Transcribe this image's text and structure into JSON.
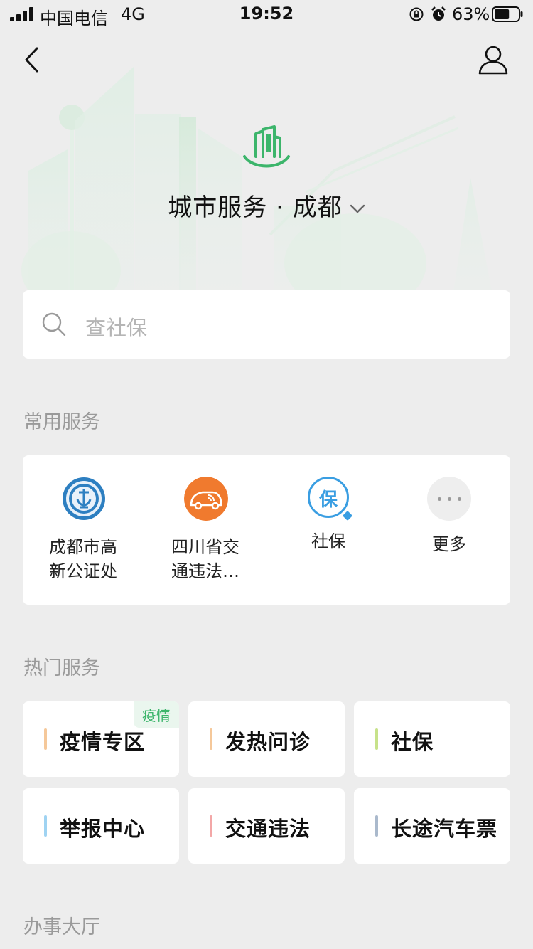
{
  "status_bar": {
    "carrier": "中国电信",
    "network": "4G",
    "time": "19:52",
    "battery_percent": "63%",
    "battery_level": 0.63
  },
  "header": {
    "back_icon": "chevron-left-icon",
    "profile_icon": "user-icon"
  },
  "hero": {
    "logo_icon": "city-building-icon",
    "title": "城市服务 · 成都",
    "accent_color": "#3cb56b"
  },
  "search": {
    "placeholder": "查社保"
  },
  "common_services": {
    "title": "常用服务",
    "items": [
      {
        "label": "成都市高\n新公证处",
        "icon": "notary-icon",
        "color": "#2d7fc1"
      },
      {
        "label": "四川省交\n通违法…",
        "icon": "car-signal-icon",
        "color": "#f07a2e"
      },
      {
        "label": "社保",
        "icon": "bao-icon",
        "color": "#3a9ee2"
      },
      {
        "label": "更多",
        "icon": "more-dots-icon",
        "color": "#eeeeee"
      }
    ]
  },
  "hot_services": {
    "title": "热门服务",
    "items": [
      {
        "label": "疫情专区",
        "bar_color": "#f5c89a",
        "tag": "疫情"
      },
      {
        "label": "发热问诊",
        "bar_color": "#f5c89a"
      },
      {
        "label": "社保",
        "bar_color": "#c7e28a"
      },
      {
        "label": "举报中心",
        "bar_color": "#9fd3f2"
      },
      {
        "label": "交通违法",
        "bar_color": "#f3a7a7"
      },
      {
        "label": "长途汽车票",
        "bar_color": "#aab9cc"
      }
    ]
  },
  "hall": {
    "title": "办事大厅"
  }
}
